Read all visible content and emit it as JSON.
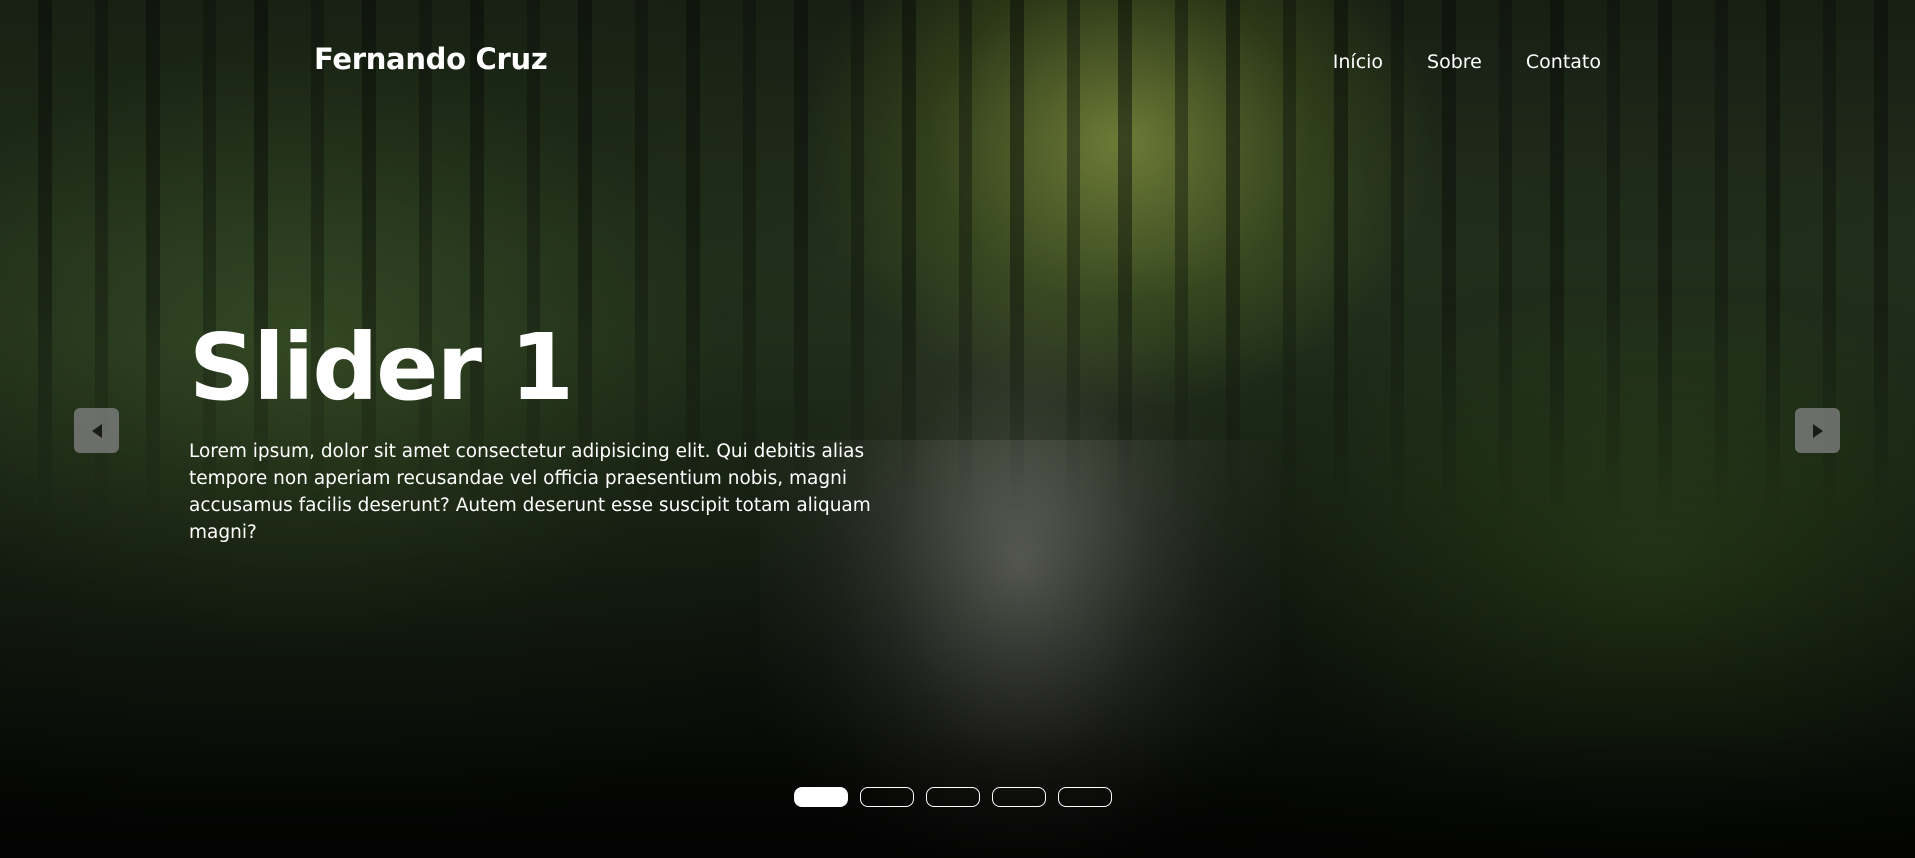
{
  "navbar": {
    "brand": "Fernando Cruz",
    "links": [
      "Início",
      "Sobre",
      "Contato"
    ]
  },
  "slide": {
    "title": "Slider 1",
    "text": "Lorem ipsum, dolor sit amet consectetur adipisicing elit. Qui debitis alias tempore non aperiam recusandae vel officia praesentium nobis, magni accusamus facilis deserunt? Autem deserunt esse suscipit totam aliquam magni?"
  },
  "controls": {
    "prev_icon": "triangle-left-icon",
    "next_icon": "triangle-right-icon"
  },
  "pagination": {
    "count": 5,
    "active_index": 0
  },
  "colors": {
    "text": "#ffffff",
    "arrow_bg": "#808080",
    "dot_active": "#ffffff"
  }
}
